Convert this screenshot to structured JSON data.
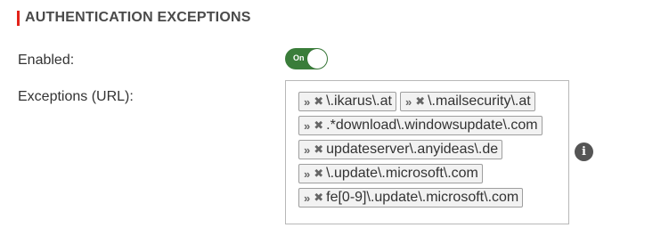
{
  "section": {
    "title": "AUTHENTICATION EXCEPTIONS",
    "accent_color": "#e2231a"
  },
  "enabled": {
    "label": "Enabled:",
    "toggle_text": "On",
    "state": true,
    "color": "#3a7d3a"
  },
  "exceptions": {
    "label": "Exceptions (URL):",
    "handle_icon": "drag-handle-icon",
    "remove_icon": "remove-icon",
    "info_icon": "info-icon",
    "items": [
      "\\.ikarus\\.at",
      "\\.mailsecurity\\.at",
      ".*download\\.windowsupdate\\.com",
      "updateserver\\.anyideas\\.de",
      "\\.update\\.microsoft\\.com",
      "fe[0-9]\\.update\\.microsoft\\.com"
    ]
  }
}
